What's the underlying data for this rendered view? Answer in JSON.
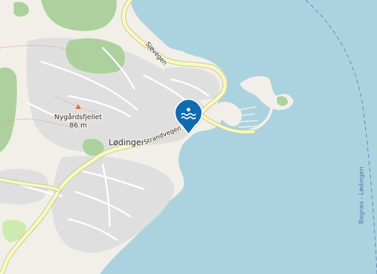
{
  "map": {
    "labels": {
      "town": "Lødingen",
      "peak_name": "Nygårdsfjellet",
      "peak_elevation": "86 m",
      "road_north": "Sjøvegen",
      "road_town": "Strandvegen",
      "ferry_route": "Bognes - Lødingen"
    },
    "marker": {
      "icon": "swimming-icon",
      "color": "#0f6bb0"
    },
    "colors": {
      "water": "#aad3df",
      "land": "#f2efe9",
      "residential": "#e0dfdf",
      "forest": "#add19e",
      "meadow": "#cdebb0",
      "road": "#f7fabf",
      "road_casing": "#c9c59a",
      "ferry": "#6b7fbf",
      "peak": "#d4703a"
    }
  }
}
